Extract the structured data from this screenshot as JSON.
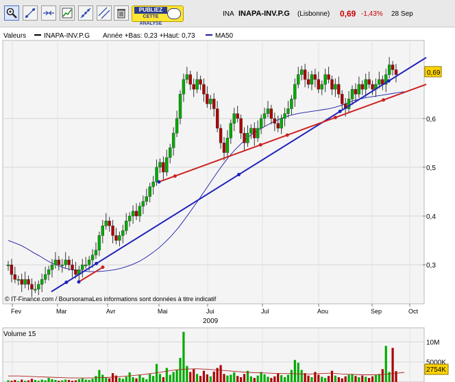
{
  "toolbar": {
    "tools": [
      "zoom-tool",
      "trendline-tool",
      "horizontal-line-tool",
      "chart-tool",
      "fibonacci-tool",
      "parallel-lines-tool",
      "delete-tool"
    ],
    "ad": {
      "line1": "PUBLIEZ",
      "line2": "CETTE",
      "line3": "ANALYSE"
    }
  },
  "quote": {
    "code": "INA",
    "name": "INAPA-INV.P.G",
    "exchange": "(Lisbonne)",
    "price": "0,69",
    "change": "-1,43%",
    "date": "28 Sep"
  },
  "legend": {
    "label": "Valeurs",
    "series_name": "INAPA-INV.P.G",
    "range_text": "Année +Bas: 0,23 +Haut: 0,73",
    "ma_label": "MA50"
  },
  "credit": "© IT-Finance.com / BoursoramaLes informations sont données à titre indicatif",
  "last_price_label": "0,69",
  "volume": {
    "title": "Volume 15",
    "last_label": "2754K"
  },
  "colors": {
    "up": "#00aa00",
    "down": "#aa0000",
    "ma": "#1a1aaa",
    "support": "#2222bb",
    "resistance": "#cc2222",
    "price_tag": "#ffd400"
  },
  "chart_data": [
    {
      "type": "candlestick",
      "title": "INAPA-INV.P.G",
      "x_ticks": [
        "Fev",
        "Mar",
        "Avr",
        "Mai",
        "Jui",
        "Jul",
        "Aou",
        "Sep",
        "Oct"
      ],
      "year_label": "2009",
      "y_ticks": [
        0.3,
        0.4,
        0.5,
        0.6
      ],
      "ylim": [
        0.22,
        0.76
      ],
      "grid": true,
      "closes": [
        0.3,
        0.28,
        0.27,
        0.27,
        0.26,
        0.27,
        0.26,
        0.25,
        0.25,
        0.26,
        0.27,
        0.28,
        0.29,
        0.3,
        0.31,
        0.3,
        0.3,
        0.31,
        0.3,
        0.29,
        0.28,
        0.29,
        0.3,
        0.3,
        0.31,
        0.32,
        0.33,
        0.36,
        0.38,
        0.39,
        0.38,
        0.36,
        0.35,
        0.36,
        0.37,
        0.39,
        0.4,
        0.41,
        0.4,
        0.42,
        0.43,
        0.44,
        0.46,
        0.47,
        0.5,
        0.51,
        0.49,
        0.52,
        0.54,
        0.57,
        0.6,
        0.65,
        0.68,
        0.69,
        0.67,
        0.66,
        0.68,
        0.67,
        0.65,
        0.63,
        0.64,
        0.62,
        0.58,
        0.55,
        0.53,
        0.56,
        0.59,
        0.61,
        0.6,
        0.57,
        0.55,
        0.57,
        0.58,
        0.56,
        0.58,
        0.6,
        0.61,
        0.62,
        0.6,
        0.59,
        0.58,
        0.6,
        0.61,
        0.62,
        0.64,
        0.67,
        0.69,
        0.7,
        0.68,
        0.67,
        0.69,
        0.68,
        0.66,
        0.67,
        0.69,
        0.68,
        0.66,
        0.67,
        0.65,
        0.63,
        0.62,
        0.64,
        0.66,
        0.65,
        0.67,
        0.66,
        0.68,
        0.67,
        0.66,
        0.67,
        0.68,
        0.67,
        0.69,
        0.71,
        0.7,
        0.69
      ],
      "ma50": [
        0.35,
        0.345,
        0.34,
        0.333,
        0.325,
        0.318,
        0.31,
        0.303,
        0.298,
        0.293,
        0.29,
        0.288,
        0.287,
        0.286,
        0.286,
        0.287,
        0.288,
        0.29,
        0.293,
        0.297,
        0.302,
        0.308,
        0.316,
        0.325,
        0.335,
        0.347,
        0.36,
        0.375,
        0.392,
        0.41,
        0.428,
        0.447,
        0.466,
        0.485,
        0.503,
        0.52,
        0.535,
        0.548,
        0.56,
        0.57,
        0.578,
        0.585,
        0.592,
        0.598,
        0.603,
        0.607,
        0.61,
        0.612,
        0.614,
        0.616,
        0.618,
        0.62,
        0.623,
        0.627,
        0.632,
        0.637,
        0.64,
        0.643,
        0.645,
        0.647,
        0.649,
        0.651,
        0.653,
        0.655
      ],
      "last_price": 0.69,
      "trendlines": [
        {
          "name": "support",
          "from": [
            "Mar",
            0.245
          ],
          "to": [
            "Oct",
            0.725
          ]
        },
        {
          "name": "resistance",
          "from": [
            "Avr",
            0.47
          ],
          "to": [
            "Oct",
            0.67
          ]
        },
        {
          "name": "resistance-early",
          "from": [
            "Mar",
            0.265
          ],
          "to": [
            "Avr",
            0.295
          ]
        }
      ]
    },
    {
      "type": "bar",
      "title": "Volume 15",
      "y_ticks": [
        "10M",
        "5000K"
      ],
      "last_value": "2754K",
      "values": [
        0.4,
        0.3,
        0.5,
        0.2,
        0.6,
        0.3,
        0.4,
        0.8,
        0.5,
        0.3,
        0.6,
        0.4,
        1.0,
        0.7,
        0.5,
        0.3,
        0.4,
        0.6,
        0.5,
        0.3,
        0.4,
        0.7,
        0.9,
        0.6,
        0.5,
        0.8,
        1.5,
        3.0,
        1.8,
        1.2,
        0.9,
        2.2,
        1.6,
        1.0,
        0.8,
        1.3,
        2.4,
        1.2,
        0.9,
        1.8,
        1.1,
        0.7,
        2.0,
        1.5,
        4.5,
        2.0,
        1.2,
        3.5,
        1.8,
        2.5,
        3.0,
        6.0,
        12.5,
        4.0,
        2.5,
        3.2,
        2.0,
        1.5,
        2.8,
        1.9,
        1.4,
        2.6,
        3.5,
        4.2,
        2.0,
        1.6,
        1.8,
        2.4,
        1.5,
        1.2,
        2.0,
        2.8,
        1.4,
        1.0,
        1.6,
        2.5,
        1.9,
        1.3,
        1.0,
        1.4,
        2.2,
        1.7,
        1.2,
        1.8,
        3.0,
        5.5,
        4.8,
        3.0,
        2.2,
        1.6,
        1.2,
        2.5,
        1.8,
        1.3,
        1.0,
        1.5,
        2.8,
        1.6,
        1.2,
        0.9,
        1.4,
        1.8,
        2.0,
        1.5,
        1.2,
        1.6,
        1.3,
        1.0,
        1.4,
        1.7,
        2.0,
        3.2,
        9.0,
        2.5,
        8.5,
        2.7
      ],
      "ma": [
        1.5,
        1.5,
        1.4,
        1.3,
        1.2,
        1.1,
        1.0,
        1.0,
        1.0,
        1.1,
        1.2,
        1.4,
        1.6,
        1.9,
        2.2,
        2.6,
        3.0,
        3.2,
        3.3,
        3.2,
        3.0,
        2.8,
        2.6,
        2.4,
        2.3,
        2.2,
        2.1,
        2.1,
        2.0,
        2.0,
        2.1,
        2.2,
        2.0,
        1.9,
        1.8,
        1.8,
        1.9,
        2.1,
        2.4
      ]
    }
  ]
}
